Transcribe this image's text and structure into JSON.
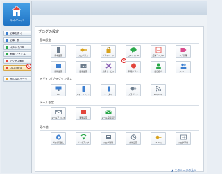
{
  "logo": {
    "label": "マイページ",
    "color": "#2b86d8"
  },
  "sidebar": {
    "items": [
      {
        "label": "記事を書く",
        "icon": "pencil-icon",
        "color": "#3b7ed0"
      },
      {
        "label": "記事一覧",
        "icon": "list-icon",
        "color": "#3b7ed0"
      },
      {
        "label": "コメント/TB",
        "icon": "comment-icon",
        "color": "#2aa84a"
      },
      {
        "label": "画像/ファイル",
        "icon": "image-icon",
        "color": "#2aa84a"
      },
      {
        "label": "アクセス解析",
        "icon": "chart-icon",
        "color": "#e2453c"
      },
      {
        "label": "ブログ設定",
        "icon": "wrench-icon",
        "color": "#e2453c",
        "active": true
      },
      {
        "label": "みんなのページ",
        "icon": "smile-icon",
        "color": "#f0a020"
      }
    ],
    "marker": "①"
  },
  "main": {
    "title": "ブログの設定",
    "marker": "②",
    "back_link": "▲ このページの上へ",
    "sections": [
      {
        "title": "基本設定",
        "tiles": [
          {
            "label": "基本設定",
            "icon": "document-icon",
            "color": "#6b7b8c"
          },
          {
            "label": "ブログパス",
            "icon": "key-icon",
            "color": "#d9a21b"
          },
          {
            "label": "プライベート",
            "icon": "lock-icon",
            "color": "#d9a21b"
          },
          {
            "label": "コメント/TB",
            "icon": "comment-icon",
            "color": "#2aa84a"
          },
          {
            "label": "記事テンプレ",
            "icon": "template-icon",
            "color": "#e2453c"
          },
          {
            "label": "タグ管理",
            "icon": "tag-icon",
            "color": "#d94b8c"
          }
        ]
      },
      {
        "title": "",
        "tiles": [
          {
            "label": "投稿設定",
            "icon": "post-icon",
            "color": "#3b7ed0"
          },
          {
            "label": "画像設定",
            "icon": "picture-icon",
            "color": "#6b7b8c"
          },
          {
            "label": "外部サービス",
            "icon": "puzzle-icon",
            "color": "#8a5fb5"
          },
          {
            "label": "利用プラン",
            "icon": "plan-icon",
            "color": "#e2453c"
          },
          {
            "label": "自己紹介",
            "icon": "profile-icon",
            "color": "#2aa84a"
          },
          {
            "label": "メンバー",
            "icon": "members-icon",
            "color": "#3b7ed0"
          }
        ]
      },
      {
        "title": "デザイン/プラグイン設定",
        "tiles": [
          {
            "label": "PC",
            "icon": "monitor-icon",
            "color": "#3b7ed0"
          },
          {
            "label": "スマートフォン",
            "icon": "smartphone-icon",
            "color": "#3b7ed0"
          },
          {
            "label": "ケータイ",
            "icon": "mobile-icon",
            "color": "#3b7ed0"
          },
          {
            "label": "プラグイン",
            "icon": "plugin-icon",
            "color": "#6b7b8c"
          },
          {
            "label": "RSS/Ping",
            "icon": "rss-icon",
            "color": "#6b7b8c"
          }
        ]
      },
      {
        "title": "メール設定",
        "tiles": [
          {
            "label": "メールアドレス設定",
            "icon": "mail-icon",
            "color": "#6b7b8c"
          },
          {
            "label": "通知設定",
            "icon": "notify-icon",
            "color": "#e2453c"
          },
          {
            "label": "メール投稿設定",
            "icon": "mail-post-icon",
            "color": "#2aa84a"
          }
        ]
      },
      {
        "title": "その他",
        "tiles": [
          {
            "label": "ブログ引越し",
            "icon": "move-icon",
            "color": "#3b7ed0"
          },
          {
            "label": "バックアップ",
            "icon": "backup-icon",
            "color": "#2aa84a"
          },
          {
            "label": "ブログ削除",
            "icon": "delete-icon",
            "color": "#6b7b8c"
          },
          {
            "label": "分析設定",
            "icon": "analysis-icon",
            "color": "#6b7b8c"
          },
          {
            "label": "API Key",
            "icon": "api-key-icon",
            "color": "#d9a21b"
          },
          {
            "label": "ブログ移動",
            "icon": "transfer-icon",
            "color": "#6b7b8c"
          }
        ]
      }
    ]
  }
}
